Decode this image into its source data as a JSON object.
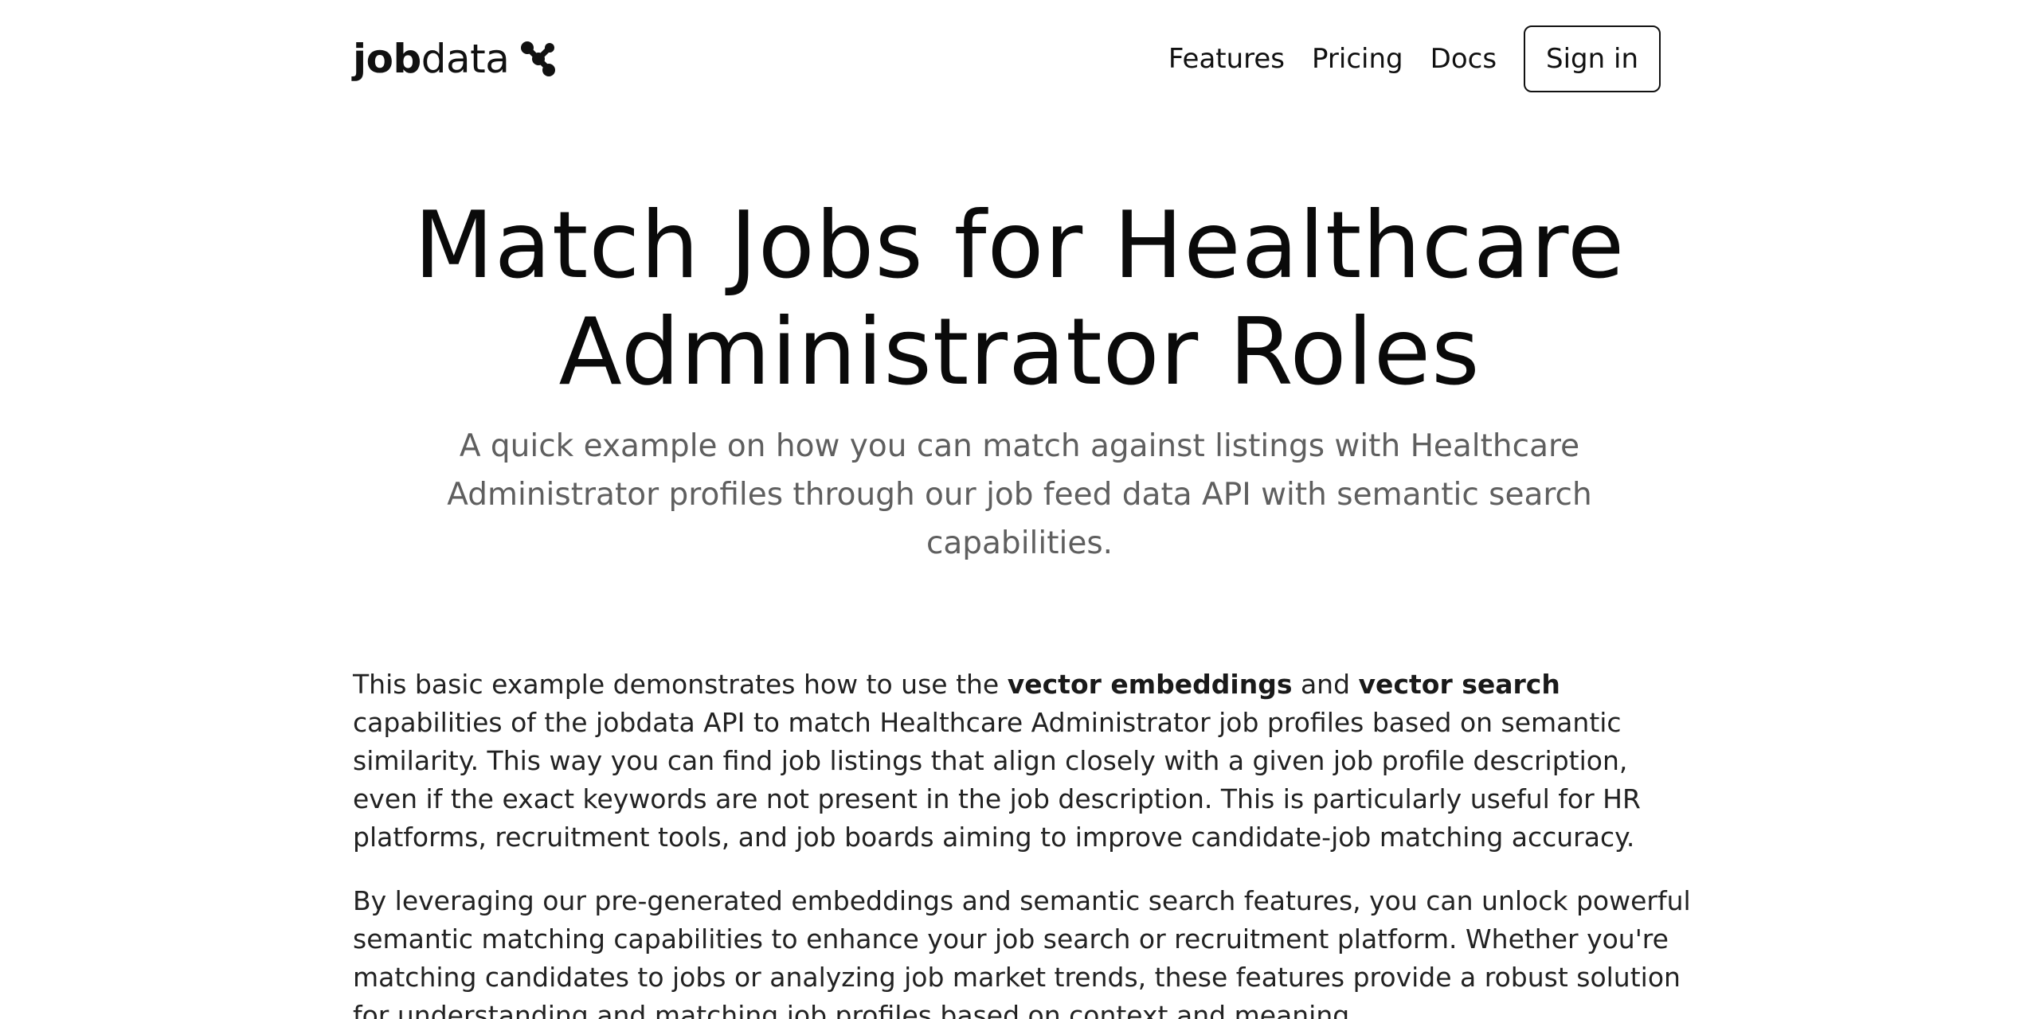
{
  "header": {
    "logo_bold": "job",
    "logo_light": "data",
    "logo_icon": "molecule-icon",
    "nav": [
      "Features",
      "Pricing",
      "Docs"
    ],
    "signin_label": "Sign in"
  },
  "hero": {
    "title_line1": "Match Jobs for Healthcare",
    "title_line2": "Administrator Roles",
    "subtitle": "A quick example on how you can match against listings with Healthcare Administrator profiles through our job feed data API with semantic search capabilities."
  },
  "content": {
    "p1_a": "This basic example demonstrates how to use the ",
    "p1_b1": "vector embeddings",
    "p1_c": " and ",
    "p1_b2": "vector search",
    "p1_d": " capabilities of the jobdata API to match Healthcare Administrator job profiles based on semantic similarity. This way you can find job listings that align closely with a given job profile description, even if the exact keywords are not present in the job description. This is particularly useful for HR platforms, recruitment tools, and job boards aiming to improve candidate-job matching accuracy.",
    "p2": "By leveraging our pre-generated embeddings and semantic search features, you can unlock powerful semantic matching capabilities to enhance your job search or recruitment platform. Whether you're matching candidates to jobs or analyzing job market trends, these features provide a robust solution for understanding and matching job profiles based on context and meaning."
  },
  "colors": {
    "text": "#1a1a1a",
    "subtitle": "#5f5f5f",
    "background": "#ffffff"
  }
}
